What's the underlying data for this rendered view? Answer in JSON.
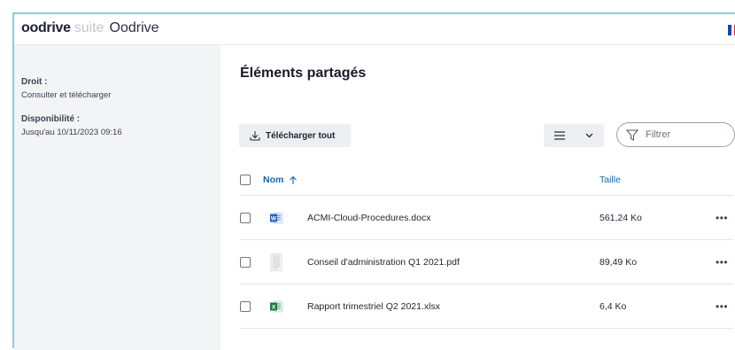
{
  "header": {
    "brand": "oodrive",
    "suite": "suite",
    "org_name": "Oodrive",
    "language_flag_icon": "french-flag-icon"
  },
  "sidebar": {
    "right_label": "Droit :",
    "right_value": "Consulter et télécharger",
    "availability_label": "Disponibilité :",
    "availability_value": "Jusqu'au 10/11/2023 09:16"
  },
  "main": {
    "title": "Éléments partagés",
    "download_all_label": "Télécharger tout",
    "download_icon": "download-icon",
    "view_toggle_icon": "list-view-icon",
    "filter_placeholder": "Filtrer",
    "filter_value": ""
  },
  "table": {
    "columns": {
      "name": "Nom",
      "size": "Taille"
    },
    "sort_icon": "arrow-up-icon",
    "rows": [
      {
        "name": "ACMI-Cloud-Procedures.docx",
        "size": "561,24 Ko",
        "icon": "word-file-icon",
        "icon_color": "#2b5fb8"
      },
      {
        "name": "Conseil d'administration Q1 2021.pdf",
        "size": "89,49 Ko",
        "icon": "pdf-thumbnail-icon",
        "icon_color": "#d9d9d9"
      },
      {
        "name": "Rapport trimestriel Q2 2021.xlsx",
        "size": "6,4 Ko",
        "icon": "excel-file-icon",
        "icon_color": "#1f7a44"
      }
    ],
    "row_menu_label": "•••"
  }
}
